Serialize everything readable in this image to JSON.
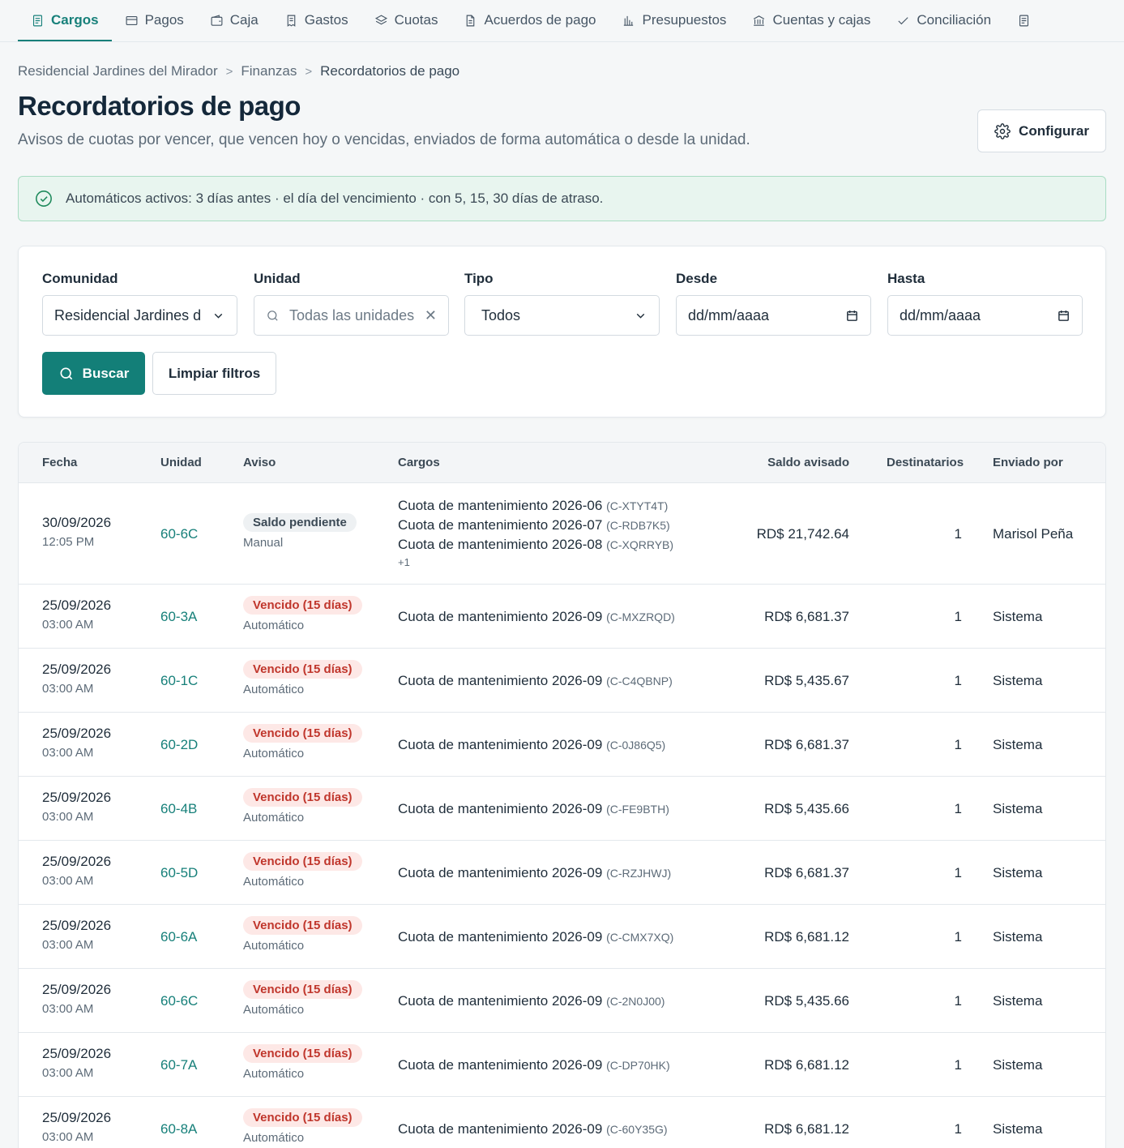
{
  "nav": {
    "tabs": [
      {
        "label": "Cargos",
        "icon": "document-icon",
        "active": true
      },
      {
        "label": "Pagos",
        "icon": "card-icon"
      },
      {
        "label": "Caja",
        "icon": "wallet-icon"
      },
      {
        "label": "Gastos",
        "icon": "receipt-icon"
      },
      {
        "label": "Cuotas",
        "icon": "layers-icon"
      },
      {
        "label": "Acuerdos de pago",
        "icon": "file-icon"
      },
      {
        "label": "Presupuestos",
        "icon": "bar-chart-icon"
      },
      {
        "label": "Cuentas y cajas",
        "icon": "bank-icon"
      },
      {
        "label": "Conciliación",
        "icon": "check-icon"
      }
    ],
    "overflow_icon": "document-icon"
  },
  "breadcrumb": {
    "items": [
      "Residencial Jardines del Mirador",
      "Finanzas",
      "Recordatorios de pago"
    ],
    "separator": ">"
  },
  "header": {
    "title": "Recordatorios de pago",
    "subtitle": "Avisos de cuotas por vencer, que vencen hoy o vencidas, enviados de forma automática o desde la unidad.",
    "config_label": "Configurar"
  },
  "banner": {
    "text": "Automáticos activos: 3 días antes · el día del vencimiento · con 5, 15, 30 días de atraso."
  },
  "filters": {
    "comunidad": {
      "label": "Comunidad",
      "value": "Residencial Jardines del Mirador"
    },
    "unidad": {
      "label": "Unidad",
      "placeholder": "Todas las unidades"
    },
    "tipo": {
      "label": "Tipo",
      "value": "Todos"
    },
    "desde": {
      "label": "Desde",
      "placeholder": "dd/mm/aaaa"
    },
    "hasta": {
      "label": "Hasta",
      "placeholder": "dd/mm/aaaa"
    },
    "search_label": "Buscar",
    "clear_label": "Limpiar filtros"
  },
  "table": {
    "columns": [
      "Fecha",
      "Unidad",
      "Aviso",
      "Cargos",
      "Saldo avisado",
      "Destinatarios",
      "Enviado por"
    ],
    "rows": [
      {
        "date": "30/09/2026",
        "time": "12:05 PM",
        "unit": "60-6C",
        "badge": "Saldo pendiente",
        "badge_type": "gray",
        "mode": "Manual",
        "charges": [
          {
            "name": "Cuota de mantenimiento 2026-06",
            "code": "(C-XTYT4T)"
          },
          {
            "name": "Cuota de mantenimiento 2026-07",
            "code": "(C-RDB7K5)"
          },
          {
            "name": "Cuota de mantenimiento 2026-08",
            "code": "(C-XQRRYB)"
          }
        ],
        "more": "+1",
        "amount": "RD$ 21,742.64",
        "recipients": "1",
        "sender": "Marisol Peña"
      },
      {
        "date": "25/09/2026",
        "time": "03:00 AM",
        "unit": "60-3A",
        "badge": "Vencido (15 días)",
        "badge_type": "red",
        "mode": "Automático",
        "charges": [
          {
            "name": "Cuota de mantenimiento 2026-09",
            "code": "(C-MXZRQD)"
          }
        ],
        "amount": "RD$ 6,681.37",
        "recipients": "1",
        "sender": "Sistema"
      },
      {
        "date": "25/09/2026",
        "time": "03:00 AM",
        "unit": "60-1C",
        "badge": "Vencido (15 días)",
        "badge_type": "red",
        "mode": "Automático",
        "charges": [
          {
            "name": "Cuota de mantenimiento 2026-09",
            "code": "(C-C4QBNP)"
          }
        ],
        "amount": "RD$ 5,435.67",
        "recipients": "1",
        "sender": "Sistema"
      },
      {
        "date": "25/09/2026",
        "time": "03:00 AM",
        "unit": "60-2D",
        "badge": "Vencido (15 días)",
        "badge_type": "red",
        "mode": "Automático",
        "charges": [
          {
            "name": "Cuota de mantenimiento 2026-09",
            "code": "(C-0J86Q5)"
          }
        ],
        "amount": "RD$ 6,681.37",
        "recipients": "1",
        "sender": "Sistema"
      },
      {
        "date": "25/09/2026",
        "time": "03:00 AM",
        "unit": "60-4B",
        "badge": "Vencido (15 días)",
        "badge_type": "red",
        "mode": "Automático",
        "charges": [
          {
            "name": "Cuota de mantenimiento 2026-09",
            "code": "(C-FE9BTH)"
          }
        ],
        "amount": "RD$ 5,435.66",
        "recipients": "1",
        "sender": "Sistema"
      },
      {
        "date": "25/09/2026",
        "time": "03:00 AM",
        "unit": "60-5D",
        "badge": "Vencido (15 días)",
        "badge_type": "red",
        "mode": "Automático",
        "charges": [
          {
            "name": "Cuota de mantenimiento 2026-09",
            "code": "(C-RZJHWJ)"
          }
        ],
        "amount": "RD$ 6,681.37",
        "recipients": "1",
        "sender": "Sistema"
      },
      {
        "date": "25/09/2026",
        "time": "03:00 AM",
        "unit": "60-6A",
        "badge": "Vencido (15 días)",
        "badge_type": "red",
        "mode": "Automático",
        "charges": [
          {
            "name": "Cuota de mantenimiento 2026-09",
            "code": "(C-CMX7XQ)"
          }
        ],
        "amount": "RD$ 6,681.12",
        "recipients": "1",
        "sender": "Sistema"
      },
      {
        "date": "25/09/2026",
        "time": "03:00 AM",
        "unit": "60-6C",
        "badge": "Vencido (15 días)",
        "badge_type": "red",
        "mode": "Automático",
        "charges": [
          {
            "name": "Cuota de mantenimiento 2026-09",
            "code": "(C-2N0J00)"
          }
        ],
        "amount": "RD$ 5,435.66",
        "recipients": "1",
        "sender": "Sistema"
      },
      {
        "date": "25/09/2026",
        "time": "03:00 AM",
        "unit": "60-7A",
        "badge": "Vencido (15 días)",
        "badge_type": "red",
        "mode": "Automático",
        "charges": [
          {
            "name": "Cuota de mantenimiento 2026-09",
            "code": "(C-DP70HK)"
          }
        ],
        "amount": "RD$ 6,681.12",
        "recipients": "1",
        "sender": "Sistema"
      },
      {
        "date": "25/09/2026",
        "time": "03:00 AM",
        "unit": "60-8A",
        "badge": "Vencido (15 días)",
        "badge_type": "red",
        "mode": "Automático",
        "charges": [
          {
            "name": "Cuota de mantenimiento 2026-09",
            "code": "(C-60Y35G)"
          }
        ],
        "amount": "RD$ 6,681.12",
        "recipients": "1",
        "sender": "Sistema"
      }
    ]
  }
}
